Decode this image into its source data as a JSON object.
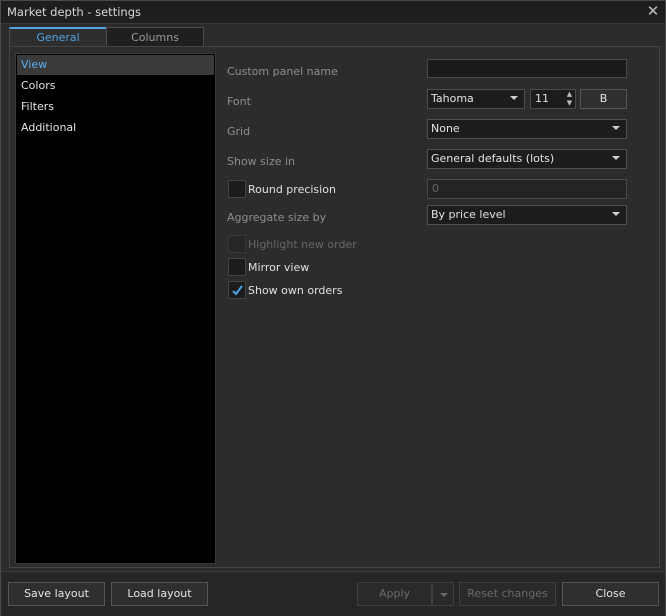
{
  "window": {
    "title": "Market depth - settings",
    "close_glyph": "✕"
  },
  "tabs": [
    {
      "label": "General",
      "active": true
    },
    {
      "label": "Columns",
      "active": false
    }
  ],
  "sidebar": {
    "items": [
      {
        "label": "View",
        "selected": true
      },
      {
        "label": "Colors",
        "selected": false
      },
      {
        "label": "Filters",
        "selected": false
      },
      {
        "label": "Additional",
        "selected": false
      }
    ]
  },
  "form": {
    "custom_panel_name": {
      "label": "Custom panel name",
      "value": ""
    },
    "font": {
      "label": "Font",
      "family": "Tahoma",
      "size": "11",
      "bold_label": "B"
    },
    "grid": {
      "label": "Grid",
      "value": "None"
    },
    "show_size_in": {
      "label": "Show size in",
      "value": "General defaults (lots)"
    },
    "round_precision": {
      "label": "Round precision",
      "checked": false,
      "value": "0"
    },
    "aggregate_size_by": {
      "label": "Aggregate size by",
      "value": "By price level"
    },
    "highlight_new_order": {
      "label": "Highlight new order",
      "checked": false,
      "enabled": false
    },
    "mirror_view": {
      "label": "Mirror view",
      "checked": false
    },
    "show_own_orders": {
      "label": "Show own orders",
      "checked": true
    }
  },
  "footer": {
    "save_layout": "Save layout",
    "load_layout": "Load layout",
    "apply": "Apply",
    "reset_changes": "Reset changes",
    "close": "Close"
  },
  "colors": {
    "accent": "#4ea3e2",
    "background": "#2b2b2b",
    "sidebar_bg": "#000000"
  }
}
